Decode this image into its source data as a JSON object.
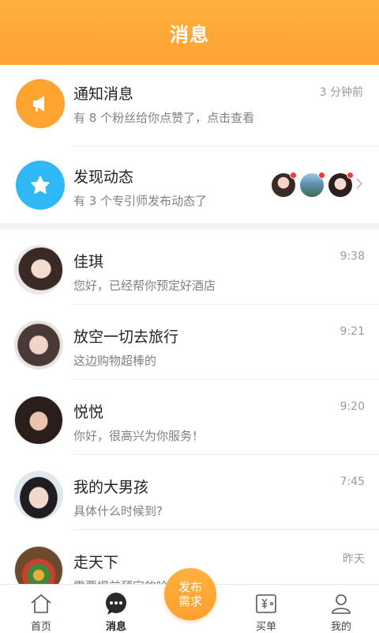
{
  "header": {
    "title": "消息"
  },
  "system": [
    {
      "title": "通知消息",
      "subtitle": "有 8 个粉丝给你点赞了，点击查看",
      "time": "3 分钟前",
      "icon": "megaphone-icon",
      "color": "#ffa22f"
    },
    {
      "title": "发现动态",
      "subtitle": "有 3 个专引师发布动态了",
      "time": "",
      "icon": "star-icon",
      "color": "#2eb8f5"
    }
  ],
  "chats": [
    {
      "name": "佳琪",
      "message": "您好，已经帮你预定好酒店",
      "time": "9:38"
    },
    {
      "name": "放空一切去旅行",
      "message": "这边购物超棒的",
      "time": "9:21"
    },
    {
      "name": "悦悦",
      "message": "你好，很高兴为你服务！",
      "time": "9:20"
    },
    {
      "name": "我的大男孩",
      "message": "具体什么时候到?",
      "time": "7:45"
    },
    {
      "name": "走天下",
      "message": "需要提前预定的哈",
      "time": "昨天"
    }
  ],
  "tabs": [
    {
      "label": "首页",
      "icon": "home-icon"
    },
    {
      "label": "消息",
      "icon": "chat-bubble-icon"
    },
    {
      "label": "买单",
      "icon": "bill-icon"
    },
    {
      "label": "我的",
      "icon": "profile-icon"
    }
  ],
  "publish": {
    "line1": "发布",
    "line2": "需求"
  },
  "colors": {
    "accent": "#ffa133",
    "blue": "#2eb8f5",
    "badge": "#f2383a"
  }
}
